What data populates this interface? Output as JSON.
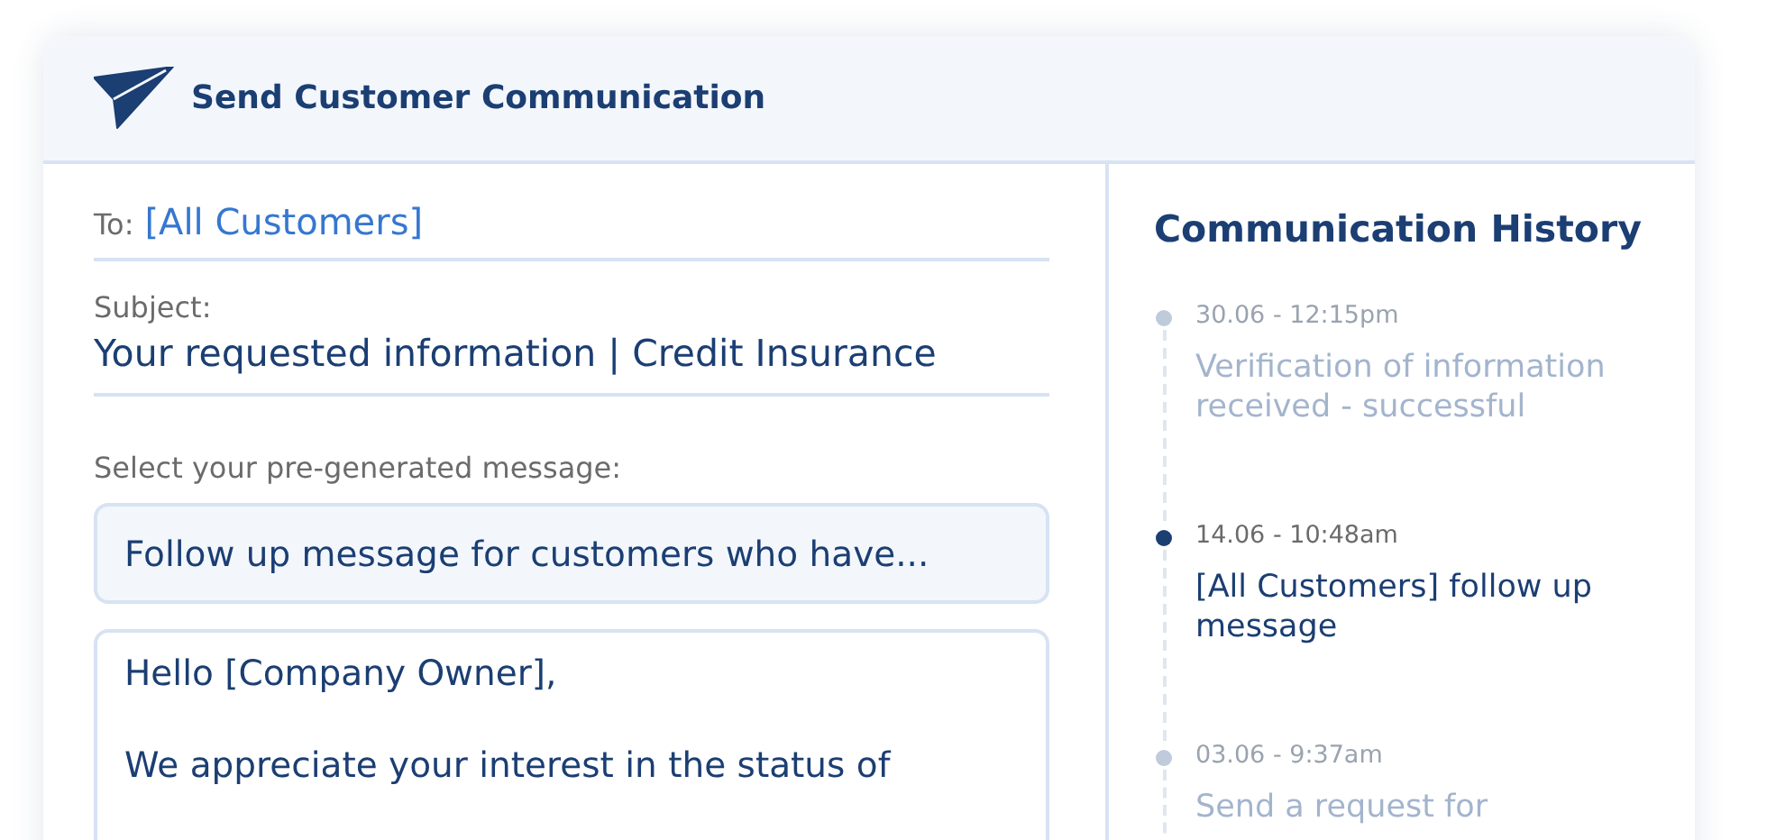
{
  "header": {
    "title": "Send Customer Communication"
  },
  "compose": {
    "to": {
      "label": "To:",
      "value": "[All Customers]"
    },
    "subject": {
      "label": "Subject:",
      "value": "Your requested information | Credit Insurance"
    },
    "template": {
      "label": "Select your pre-generated message:",
      "value": "Follow up message for customers who have..."
    },
    "body": [
      "Hello [Company Owner],",
      "We appreciate your interest in the status of"
    ]
  },
  "history": {
    "title": "Communication History",
    "items": [
      {
        "date": "30.06 - 12:15pm",
        "text": "Verification of information received - successful",
        "selected": false
      },
      {
        "date": "14.06 - 10:48am",
        "text": "[All Customers] follow up message",
        "selected": true
      },
      {
        "date": "03.06 - 9:37am",
        "text": "Send a request for",
        "selected": false
      }
    ]
  }
}
